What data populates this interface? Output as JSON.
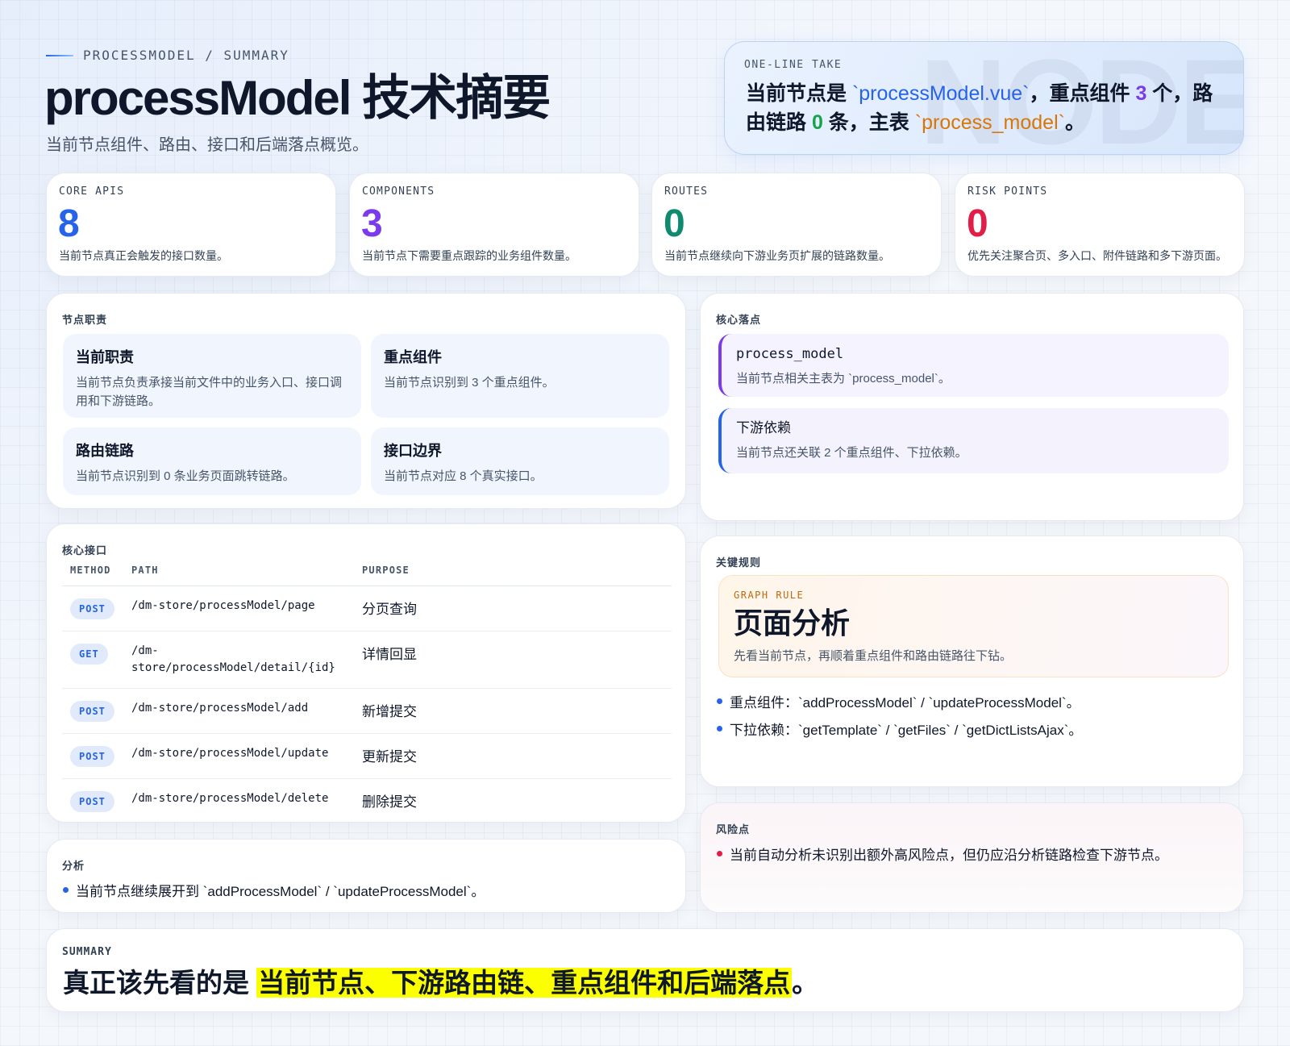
{
  "header": {
    "eyebrow": "PROCESSMODEL / SUMMARY",
    "title": "processModel 技术摘要",
    "subtitle": "当前节点组件、路由、接口和后端落点概览。"
  },
  "take": {
    "label": "ONE-LINE TAKE",
    "watermark": "NODE",
    "t1": "当前节点是 ",
    "file": "`processModel.vue`",
    "t2": "，重点组件 ",
    "components": "3",
    "t3": " 个，路由链路 ",
    "routes": "0",
    "t4": " 条，主表 ",
    "table": "`process_model`",
    "t5": "。"
  },
  "stats": [
    {
      "label": "CORE APIS",
      "value": "8",
      "desc": "当前节点真正会触发的接口数量。",
      "color": "#2563eb"
    },
    {
      "label": "COMPONENTS",
      "value": "3",
      "desc": "当前节点下需要重点跟踪的业务组件数量。",
      "color": "#7c3aed"
    },
    {
      "label": "ROUTES",
      "value": "0",
      "desc": "当前节点继续向下游业务页扩展的链路数量。",
      "color": "#0f8a6e"
    },
    {
      "label": "RISK POINTS",
      "value": "0",
      "desc": "优先关注聚合页、多入口、附件链路和多下游页面。",
      "color": "#e11d48"
    }
  ],
  "duties": {
    "label": "节点职责",
    "items": [
      {
        "title": "当前职责",
        "desc": "当前节点负责承接当前文件中的业务入口、接口调用和下游链路。"
      },
      {
        "title": "重点组件",
        "desc": "当前节点识别到 3 个重点组件。"
      },
      {
        "title": "路由链路",
        "desc": "当前节点识别到 0 条业务页面跳转链路。"
      },
      {
        "title": "接口边界",
        "desc": "当前节点对应 8 个真实接口。"
      }
    ]
  },
  "landing": {
    "label": "核心落点",
    "items": [
      {
        "title": "process_model",
        "desc": "当前节点相关主表为 `process_model`。"
      },
      {
        "title": "下游依赖",
        "desc": "当前节点还关联 2 个重点组件、下拉依赖。"
      }
    ]
  },
  "apis": {
    "label": "核心接口",
    "headers": [
      "METHOD",
      "PATH",
      "PURPOSE"
    ],
    "rows": [
      {
        "method": "POST",
        "path": "/dm-store/processModel/page",
        "purpose": "分页查询"
      },
      {
        "method": "GET",
        "path": "/dm-store/processModel/detail/{id}",
        "purpose": "详情回显"
      },
      {
        "method": "POST",
        "path": "/dm-store/processModel/add",
        "purpose": "新增提交"
      },
      {
        "method": "POST",
        "path": "/dm-store/processModel/update",
        "purpose": "更新提交"
      },
      {
        "method": "POST",
        "path": "/dm-store/processModel/delete",
        "purpose": "删除提交"
      }
    ]
  },
  "rules": {
    "label": "关键规则",
    "box_label": "GRAPH RULE",
    "box_title": "页面分析",
    "box_desc": "先看当前节点，再顺着重点组件和路由链路往下钻。",
    "bullets": [
      "重点组件：`addProcessModel` / `updateProcessModel`。",
      "下拉依赖：`getTemplate` / `getFiles` / `getDictListsAjax`。"
    ]
  },
  "analysis": {
    "label": "分析",
    "bullets": [
      "当前节点继续展开到 `addProcessModel` / `updateProcessModel`。"
    ]
  },
  "risks": {
    "label": "风险点",
    "bullets": [
      "当前自动分析未识别出额外高风险点，但仍应沿分析链路检查下游节点。"
    ]
  },
  "summary": {
    "label": "SUMMARY",
    "lead": "真正该先看的是 ",
    "highlight": "当前节点、下游路由链、重点组件和后端落点",
    "tail": "。"
  }
}
